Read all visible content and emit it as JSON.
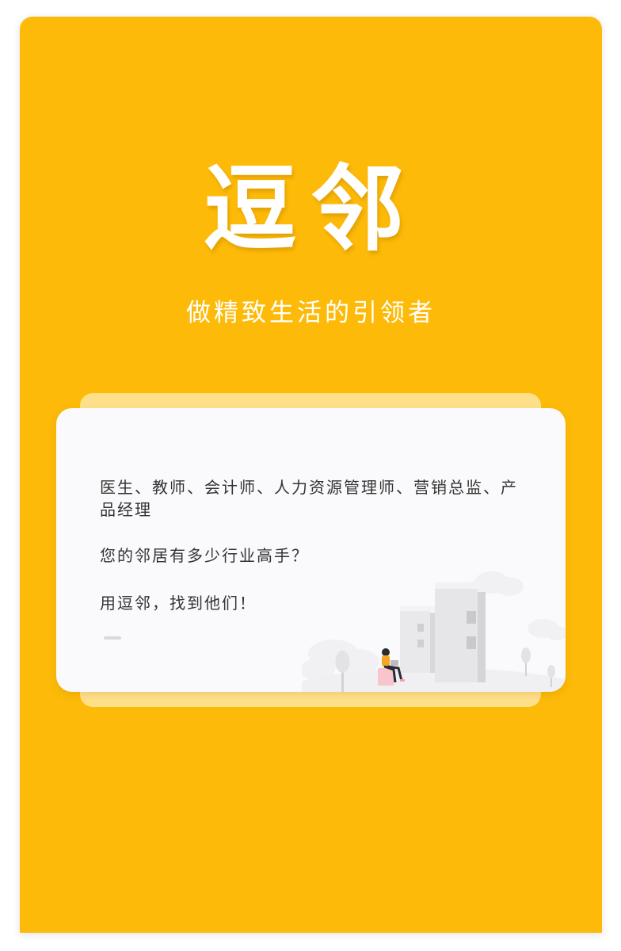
{
  "app": {
    "title": "逗邻",
    "slogan": "做精致生活的引领者"
  },
  "card": {
    "professions": "医生、教师、会计师、人力资源管理师、营销总监、产品经理",
    "question": "您的邻居有多少行业高手？",
    "call_to_action": "用逗邻，找到他们！"
  },
  "colors": {
    "brand_yellow": "#FDBA08",
    "card_back": "#FFE08A",
    "card_bg": "#FAFAFC",
    "text": "#333333"
  },
  "icons": {
    "illustration": "city-buildings-person-illustration"
  }
}
